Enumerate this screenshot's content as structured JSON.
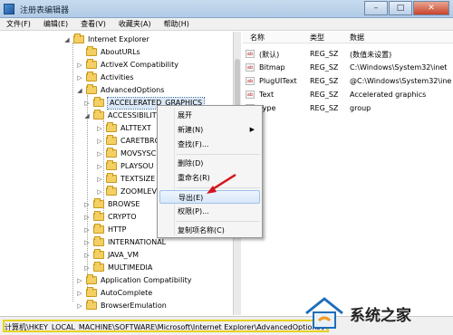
{
  "window": {
    "title": "注册表编辑器",
    "buttons": {
      "minimize": "–",
      "maximize": "□",
      "close": "✕"
    }
  },
  "menubar": [
    "文件(F)",
    "编辑(E)",
    "查看(V)",
    "收藏夹(A)",
    "帮助(H)"
  ],
  "tree": {
    "items": [
      {
        "label": "Internet Explorer",
        "expander": "◢"
      },
      {
        "label": "AboutURLs",
        "expander": ""
      },
      {
        "label": "ActiveX Compatibility",
        "expander": "▷"
      },
      {
        "label": "Activities",
        "expander": "▷"
      },
      {
        "label": "AdvancedOptions",
        "expander": "◢"
      },
      {
        "label": "ACCELERATED_GRAPHICS",
        "expander": "▷"
      },
      {
        "label": "ACCESSIBILITY",
        "expander": "◢"
      },
      {
        "label": "ALTTEXT",
        "expander": "▷"
      },
      {
        "label": "CARETBRO",
        "expander": "▷"
      },
      {
        "label": "MOVSYSC",
        "expander": "▷"
      },
      {
        "label": "PLAYSOU",
        "expander": "▷"
      },
      {
        "label": "TEXTSIZE",
        "expander": "▷"
      },
      {
        "label": "ZOOMLEV",
        "expander": "▷"
      },
      {
        "label": "BROWSE",
        "expander": "▷"
      },
      {
        "label": "CRYPTO",
        "expander": "▷"
      },
      {
        "label": "HTTP",
        "expander": "▷"
      },
      {
        "label": "INTERNATIONAL",
        "expander": "▷"
      },
      {
        "label": "JAVA_VM",
        "expander": "▷"
      },
      {
        "label": "MULTIMEDIA",
        "expander": "▷"
      },
      {
        "label": "Application Compatibility",
        "expander": "▷"
      },
      {
        "label": "AutoComplete",
        "expander": "▷"
      },
      {
        "label": "BrowserEmulation",
        "expander": "▷"
      }
    ]
  },
  "list": {
    "headers": {
      "name": "名称",
      "type": "类型",
      "data": "数据"
    },
    "rows": [
      {
        "icon": "ab",
        "name": "(默认)",
        "type": "REG_SZ",
        "data": "(数值未设置)"
      },
      {
        "icon": "ab",
        "name": "Bitmap",
        "type": "REG_SZ",
        "data": "C:\\Windows\\System32\\inet"
      },
      {
        "icon": "ab",
        "name": "PlugUIText",
        "type": "REG_SZ",
        "data": "@C:\\Windows\\System32\\ine"
      },
      {
        "icon": "ab",
        "name": "Text",
        "type": "REG_SZ",
        "data": "Accelerated graphics"
      },
      {
        "icon": "ab",
        "name": "Type",
        "type": "REG_SZ",
        "data": "group"
      }
    ]
  },
  "context_menu": {
    "items": [
      {
        "label": "展开",
        "submenu": ""
      },
      {
        "label": "新建(N)",
        "submenu": "▶"
      },
      {
        "label": "查找(F)...",
        "submenu": ""
      },
      {
        "label": "删除(D)",
        "submenu": ""
      },
      {
        "label": "重命名(R)",
        "submenu": ""
      },
      {
        "label": "导出(E)",
        "submenu": ""
      },
      {
        "label": "权限(P)...",
        "submenu": ""
      },
      {
        "label": "复制项名称(C)",
        "submenu": ""
      }
    ]
  },
  "statusbar": {
    "path": "计算机\\HKEY_LOCAL_MACHINE\\SOFTWARE\\Microsoft\\Internet Explorer\\AdvancedOptions\\ACCELERATED_GRAPHICS"
  },
  "watermark": {
    "text": "系统之家"
  },
  "colors": {
    "highlight_border": "#e7d21e",
    "arrow_red": "#d4161c",
    "title_bar": "#b9d1ea"
  }
}
